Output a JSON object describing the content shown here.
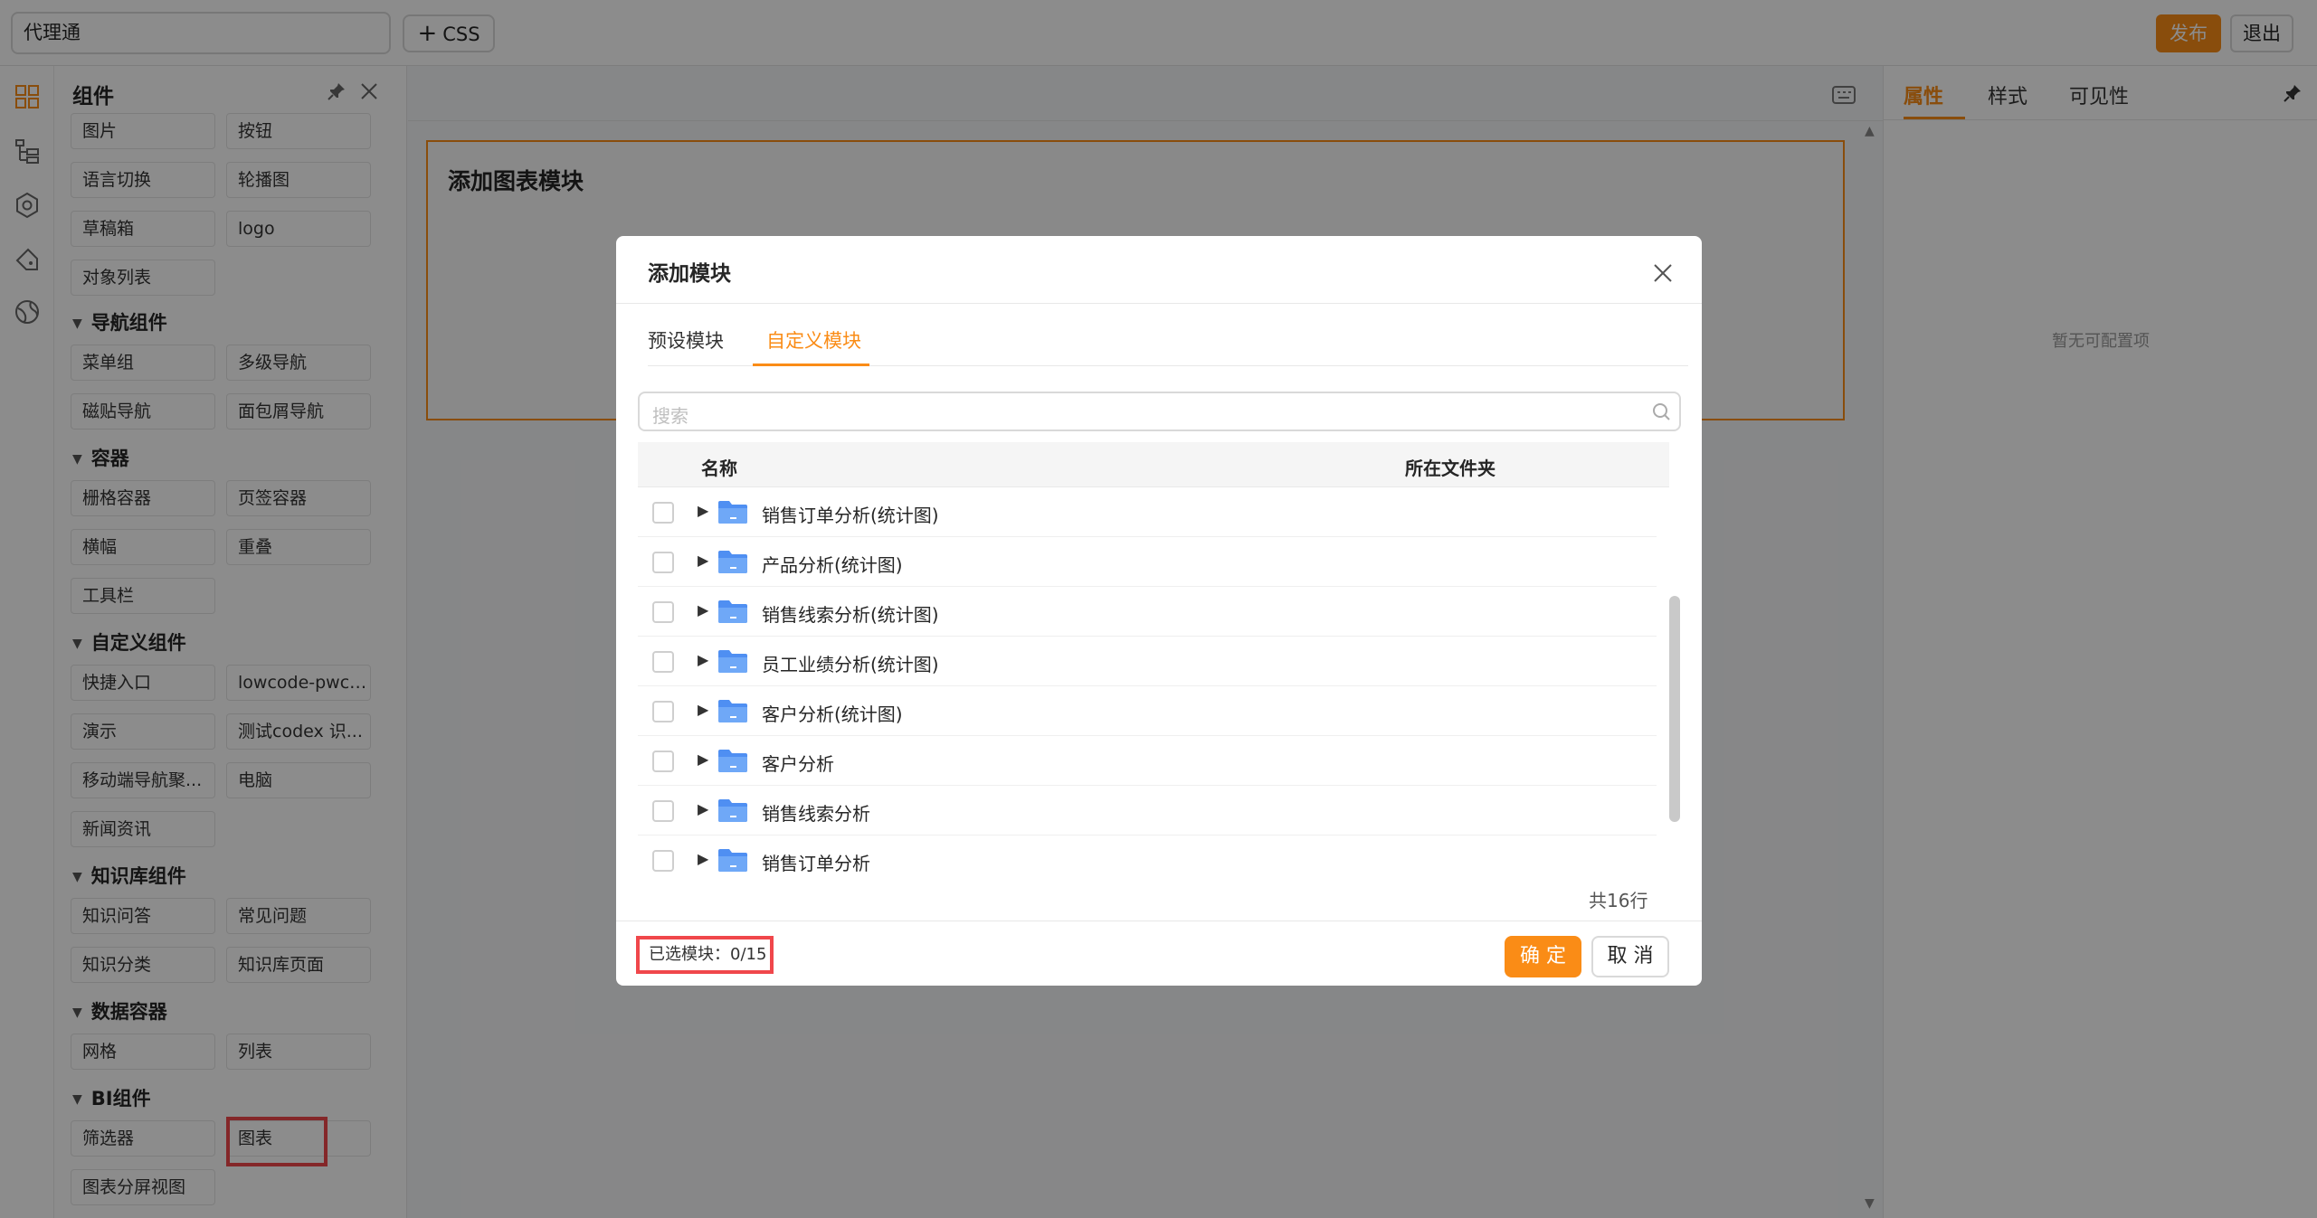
{
  "topbar": {
    "app_name": "代理通",
    "css_label": "CSS",
    "publish_label": "发布",
    "exit_label": "退出"
  },
  "panel": {
    "title": "组件",
    "items_top": [
      {
        "label": "图片",
        "col": 1
      },
      {
        "label": "按钮",
        "col": 2
      },
      {
        "label": "语言切换",
        "col": 1
      },
      {
        "label": "轮播图",
        "col": 2
      },
      {
        "label": "草稿箱",
        "col": 1
      },
      {
        "label": "logo",
        "col": 2
      },
      {
        "label": "对象列表",
        "col": 1
      }
    ],
    "groups": [
      {
        "title": "导航组件",
        "items": [
          "菜单组",
          "多级导航",
          "磁贴导航",
          "面包屑导航"
        ]
      },
      {
        "title": "容器",
        "items": [
          "栅格容器",
          "页签容器",
          "横幅",
          "重叠",
          "工具栏"
        ]
      },
      {
        "title": "自定义组件",
        "items": [
          "快捷入口",
          "lowcode-pwc-...",
          "演示",
          "测试codex 识...",
          "移动端导航聚...",
          "电脑",
          "新闻资讯"
        ]
      },
      {
        "title": "知识库组件",
        "items": [
          "知识问答",
          "常见问题",
          "知识分类",
          "知识库页面"
        ]
      },
      {
        "title": "数据容器",
        "items": [
          "网格",
          "列表"
        ]
      },
      {
        "title": "BI组件",
        "items": [
          "筛选器",
          "图表",
          "图表分屏视图"
        ]
      }
    ]
  },
  "canvas": {
    "block_title": "添加图表模块"
  },
  "props": {
    "tabs": [
      "属性",
      "样式",
      "可见性"
    ],
    "empty_text": "暂无可配置项"
  },
  "modal": {
    "title": "添加模块",
    "tabs": [
      "预设模块",
      "自定义模块"
    ],
    "active_tab": "自定义模块",
    "search_placeholder": "搜索",
    "columns": [
      "名称",
      "所在文件夹"
    ],
    "rows": [
      "销售订单分析(统计图)",
      "产品分析(统计图)",
      "销售线索分析(统计图)",
      "员工业绩分析(统计图)",
      "客户分析(统计图)",
      "客户分析",
      "销售线索分析",
      "销售订单分析"
    ],
    "total_text": "共16行",
    "selected_text": "已选模块：0/15",
    "confirm_label": "确 定",
    "cancel_label": "取 消"
  },
  "colors": {
    "accent": "#fa8c16",
    "highlight": "#f0474b",
    "folder": "#5b9cf5"
  }
}
